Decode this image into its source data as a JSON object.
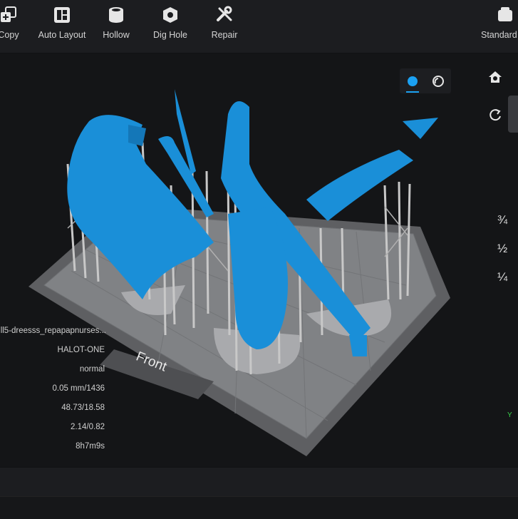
{
  "toolbar": {
    "tools": [
      {
        "label": "Copy",
        "icon": "copy-icon"
      },
      {
        "label": "Auto Layout",
        "icon": "auto-layout-icon"
      },
      {
        "label": "Hollow",
        "icon": "hollow-icon"
      },
      {
        "label": "Dig Hole",
        "icon": "dig-hole-icon"
      },
      {
        "label": "Repair",
        "icon": "repair-icon"
      },
      {
        "label": "Standard",
        "icon": "standard-icon"
      }
    ]
  },
  "viewport": {
    "bed_label": "Front",
    "height_marks": [
      "¾",
      "½",
      "¼"
    ],
    "axis_label": "Y"
  },
  "info_panel": {
    "file_name": "ll5-dreesss_repapapnurses...",
    "printer": "HALOT-ONE",
    "mode": "normal",
    "layer": "0.05 mm/1436",
    "volume": "48.73/18.58",
    "cost": "2.14/0.82",
    "time": "8h7m9s"
  },
  "colors": {
    "model": "#1a8fd8",
    "support": "#c8c8c8",
    "accent": "#1ba1f2"
  }
}
